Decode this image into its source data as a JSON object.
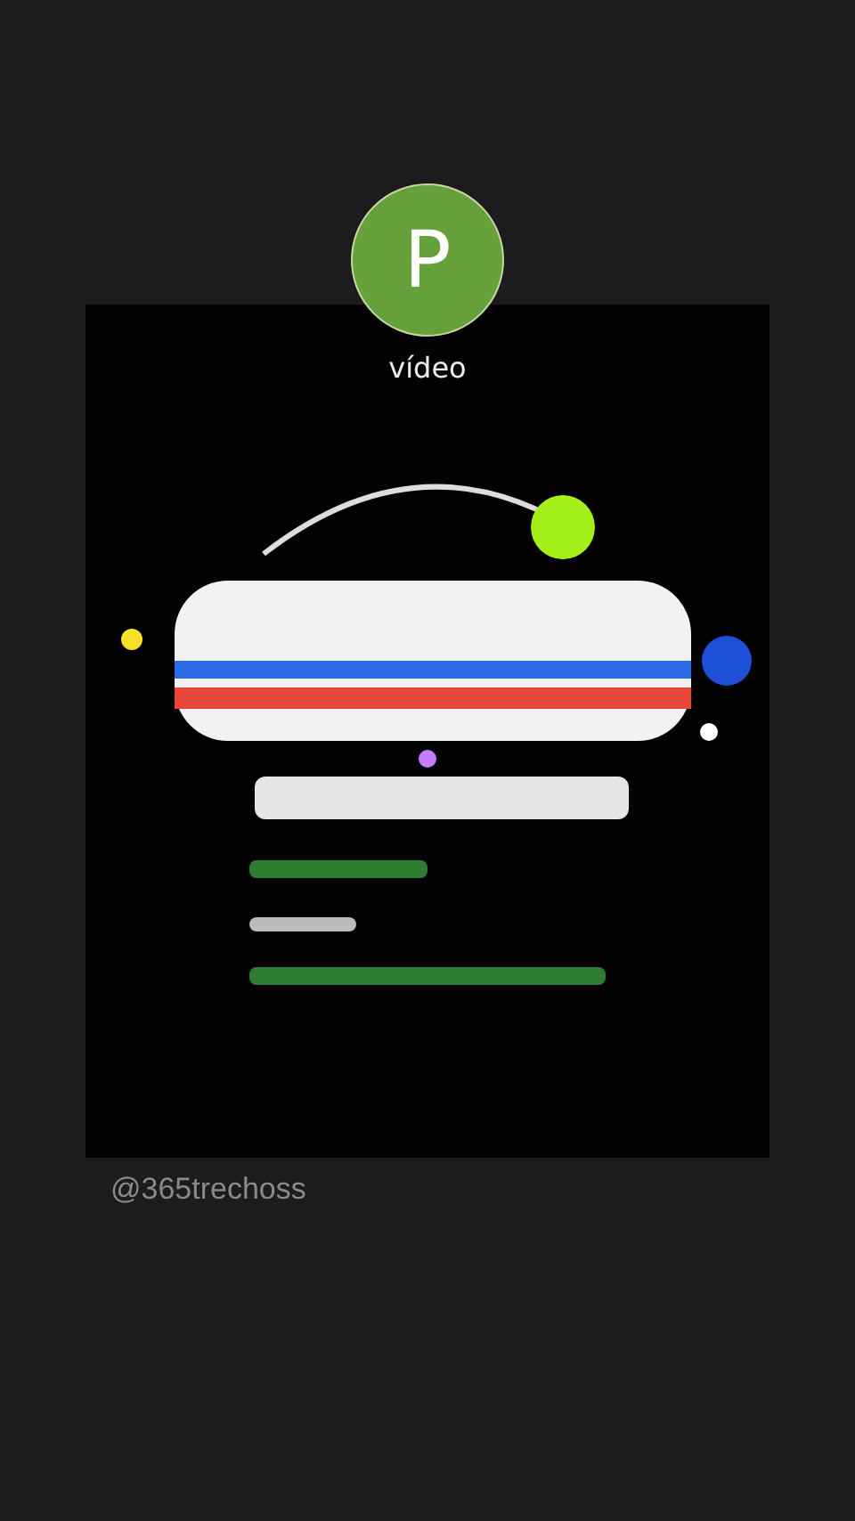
{
  "avatar": {
    "initial": "P",
    "label": "vídeo"
  },
  "caption": "@365trechoss"
}
